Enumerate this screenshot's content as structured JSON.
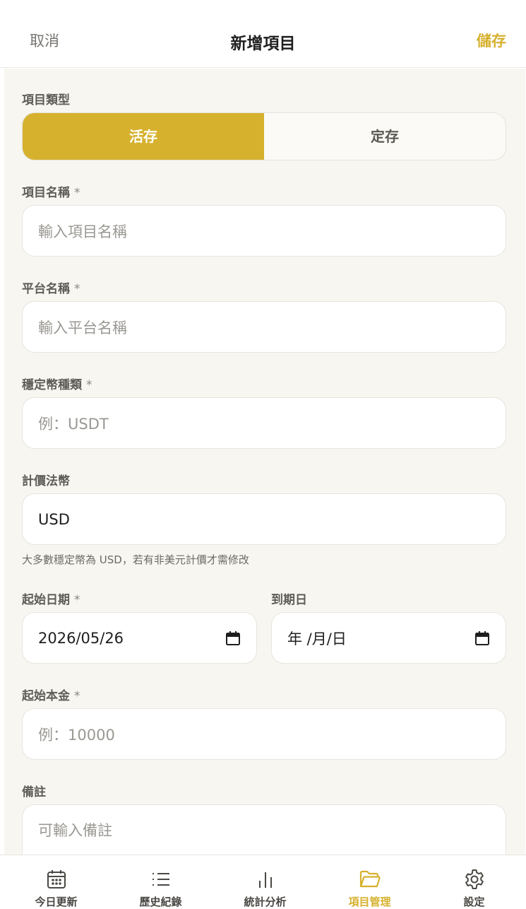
{
  "header": {
    "cancel_label": "取消",
    "title": "新增項目",
    "save_label": "儲存"
  },
  "form": {
    "type_label": "項目類型",
    "type_options": [
      "活存",
      "定存"
    ],
    "type_selected": "活存",
    "name": {
      "label": "項目名稱",
      "required": "*",
      "placeholder": "輸入項目名稱",
      "value": ""
    },
    "platform": {
      "label": "平台名稱",
      "required": "*",
      "placeholder": "輸入平台名稱",
      "value": ""
    },
    "stablecoin": {
      "label": "穩定幣種類",
      "required": "*",
      "placeholder": "例：USDT",
      "value": ""
    },
    "fiat": {
      "label": "計價法幣",
      "value": "USD",
      "hint": "大多數穩定幣為 USD，若有非美元計價才需修改"
    },
    "start_date": {
      "label": "起始日期",
      "required": "*",
      "value": "2026/05/26"
    },
    "end_date": {
      "label": "到期日",
      "value": "",
      "placeholder": "年 /月/日"
    },
    "principal": {
      "label": "起始本金",
      "required": "*",
      "placeholder": "例：10000",
      "value": ""
    },
    "note": {
      "label": "備註",
      "placeholder": "可輸入備註",
      "value": ""
    }
  },
  "nav": {
    "items": [
      {
        "label": "今日更新",
        "icon": "calendar-icon"
      },
      {
        "label": "歷史紀錄",
        "icon": "list-icon"
      },
      {
        "label": "統計分析",
        "icon": "bar-chart-icon"
      },
      {
        "label": "項目管理",
        "icon": "folder-icon"
      },
      {
        "label": "設定",
        "icon": "gear-icon"
      }
    ],
    "active": "項目管理"
  },
  "colors": {
    "accent": "#d6b12e",
    "background": "#f7f6f1",
    "field_bg": "#ffffff"
  }
}
